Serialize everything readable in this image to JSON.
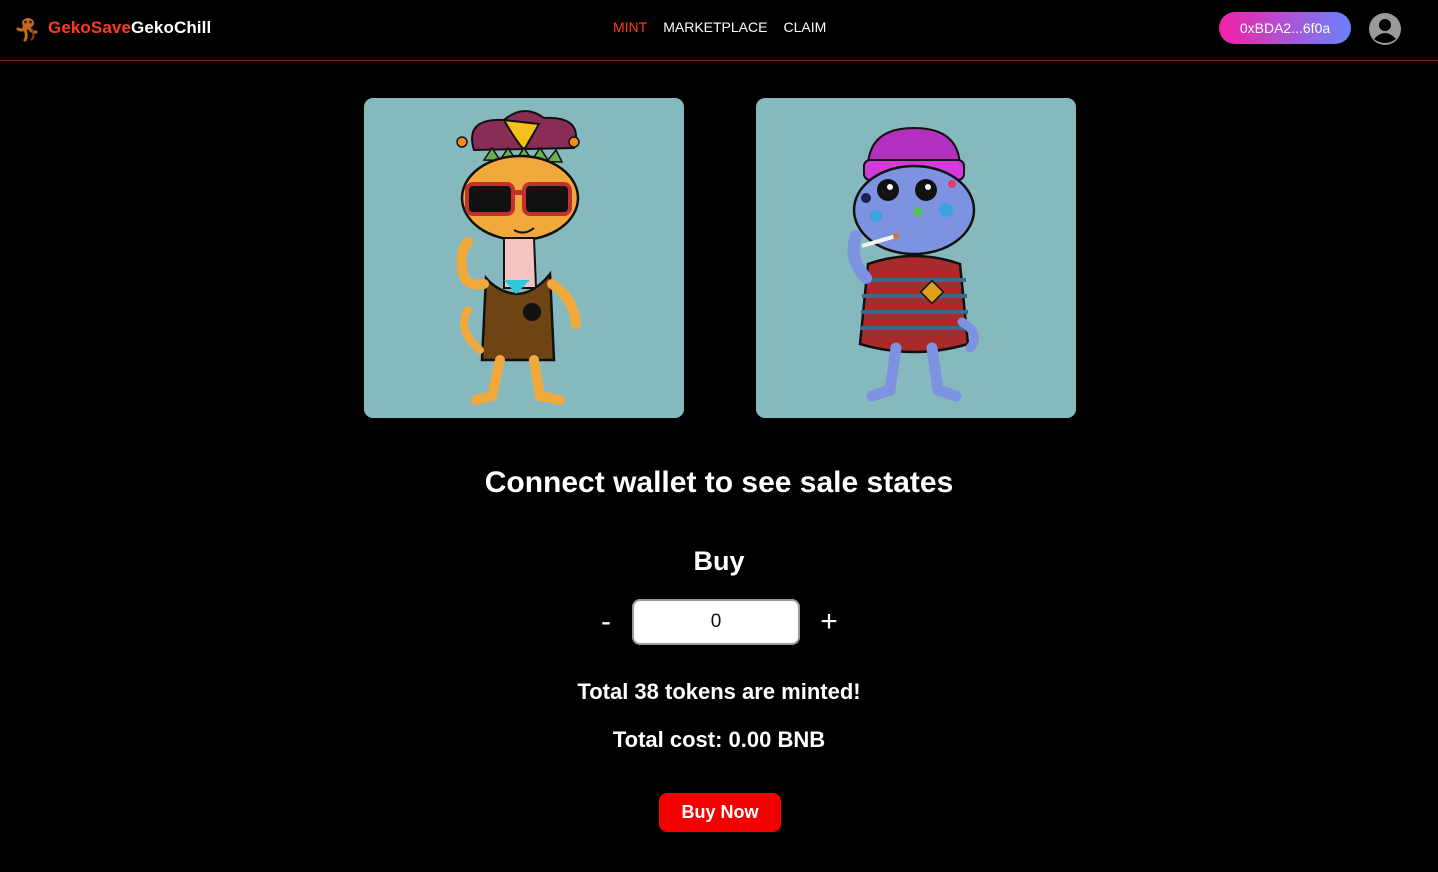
{
  "header": {
    "brand_part1": "GekoSave",
    "brand_part2": "GekoChill",
    "nav": [
      {
        "label": "MINT",
        "active": true
      },
      {
        "label": "MARKETPLACE",
        "active": false
      },
      {
        "label": "CLAIM",
        "active": false
      }
    ],
    "wallet_address": "0xBDA2...6f0a"
  },
  "nft_previews": [
    {
      "icon": "jester-gecko-nft"
    },
    {
      "icon": "beanie-gecko-nft"
    }
  ],
  "main": {
    "headline": "Connect wallet to see sale states",
    "buy_title": "Buy",
    "minus_label": "-",
    "plus_label": "+",
    "quantity": "0",
    "minted_text": "Total 38 tokens are minted!",
    "cost_text": "Total cost: 0.00 BNB",
    "buy_now_label": "Buy Now"
  },
  "colors": {
    "background": "#000000",
    "brand_accent": "#ff3b1f",
    "card_bg": "#86b9bd",
    "wallet_gradient_start": "#f51fa8",
    "wallet_gradient_end": "#6a83ff",
    "buy_now_bg": "#f30000"
  }
}
